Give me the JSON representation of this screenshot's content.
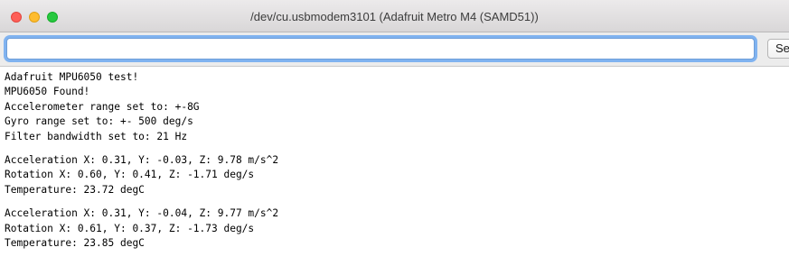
{
  "window": {
    "title": "/dev/cu.usbmodem3101 (Adafruit Metro M4 (SAMD51))",
    "traffic_lights": {
      "close_color": "#fe5f57",
      "minimize_color": "#febc2e",
      "zoom_color": "#28c840"
    }
  },
  "toolbar": {
    "input_value": "",
    "input_placeholder": "",
    "send_label": "Send",
    "focus_ring_color": "#80b3f0"
  },
  "console": {
    "blocks": [
      [
        "Adafruit MPU6050 test!",
        "MPU6050 Found!",
        "Accelerometer range set to: +-8G",
        "Gyro range set to: +- 500 deg/s",
        "Filter bandwidth set to: 21 Hz"
      ],
      [
        "Acceleration X: 0.31, Y: -0.03, Z: 9.78 m/s^2",
        "Rotation X: 0.60, Y: 0.41, Z: -1.71 deg/s",
        "Temperature: 23.72 degC"
      ],
      [
        "Acceleration X: 0.31, Y: -0.04, Z: 9.77 m/s^2",
        "Rotation X: 0.61, Y: 0.37, Z: -1.73 deg/s",
        "Temperature: 23.85 degC"
      ]
    ]
  }
}
